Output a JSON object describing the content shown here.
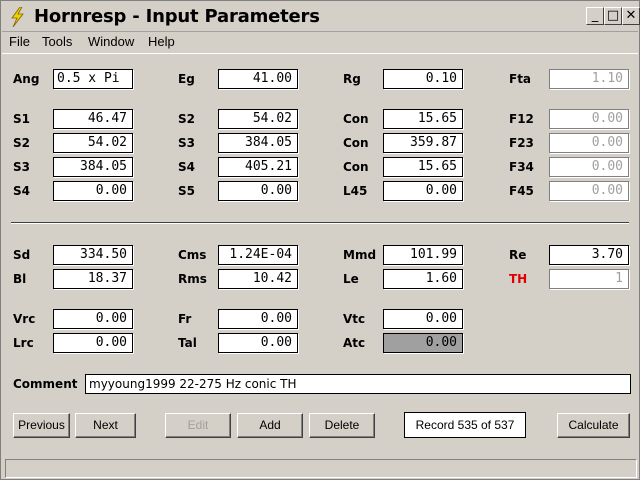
{
  "window": {
    "title": "Hornresp - Input Parameters",
    "controls": {
      "minimize": "_",
      "maximize": "□",
      "close": "✕"
    }
  },
  "menu": [
    "File",
    "Tools",
    "Window",
    "Help"
  ],
  "params": {
    "Ang": "0.5 x Pi",
    "Eg": "41.00",
    "Rg": "0.10",
    "Fta": "1.10",
    "S1": "46.47",
    "S2a": "54.02",
    "Con1": "15.65",
    "F12": "0.00",
    "S2": "54.02",
    "S3a": "384.05",
    "Con2": "359.87",
    "F23": "0.00",
    "S3": "384.05",
    "S4a": "405.21",
    "Con3": "15.65",
    "F34": "0.00",
    "S4": "0.00",
    "S5": "0.00",
    "L45": "0.00",
    "F45": "0.00",
    "Sd": "334.50",
    "Cms": "1.24E-04",
    "Mmd": "101.99",
    "Re": "3.70",
    "Bl": "18.37",
    "Rms": "10.42",
    "Le": "1.60",
    "TH": "1",
    "Vrc": "0.00",
    "Fr": "0.00",
    "Vtc": "0.00",
    "Lrc": "0.00",
    "Tal": "0.00",
    "Atc": "0.00"
  },
  "labels": {
    "Ang": "Ang",
    "Eg": "Eg",
    "Rg": "Rg",
    "Fta": "Fta",
    "S1": "S1",
    "S2": "S2",
    "Con": "Con",
    "F12": "F12",
    "S3": "S3",
    "F23": "F23",
    "S4": "S4",
    "F34": "F34",
    "S5": "S5",
    "L45": "L45",
    "F45": "F45",
    "Sd": "Sd",
    "Cms": "Cms",
    "Mmd": "Mmd",
    "Re": "Re",
    "Bl": "Bl",
    "Rms": "Rms",
    "Le": "Le",
    "TH": "TH",
    "Vrc": "Vrc",
    "Fr": "Fr",
    "Vtc": "Vtc",
    "Lrc": "Lrc",
    "Tal": "Tal",
    "Atc": "Atc",
    "Comment": "Comment"
  },
  "comment": "myyoung1999 22-275 Hz conic TH",
  "buttons": {
    "previous": "Previous",
    "next": "Next",
    "edit": "Edit",
    "add": "Add",
    "delete": "Delete",
    "calculate": "Calculate"
  },
  "record": "Record 535 of 537",
  "colors": {
    "face": "#d4d0c8",
    "th_label": "#e00000",
    "disabled_text": "#a0a0a0"
  }
}
